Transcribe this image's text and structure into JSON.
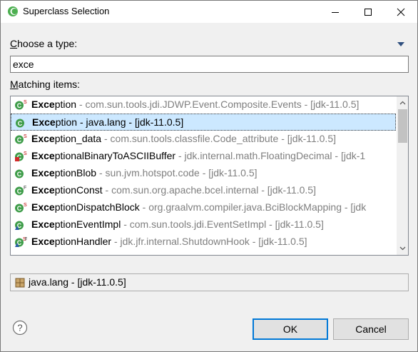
{
  "window": {
    "title": "Superclass Selection",
    "title_icon": "eclipse-icon",
    "controls": [
      "minimize-icon",
      "maximize-icon",
      "close-icon"
    ]
  },
  "form": {
    "type_label_mnemonic": "C",
    "type_label_rest": "hoose a type:",
    "search_value": "exce",
    "matching_label_mnemonic": "M",
    "matching_label_rest": "atching items:"
  },
  "items": [
    {
      "bold": "Exce",
      "rest": "ption",
      "pkg": " - com.sun.tools.jdi.JDWP.Event.Composite.Events - [jdk-11.0.5]",
      "icon": "class-static-icon",
      "selected": false
    },
    {
      "bold": "Exce",
      "rest": "ption - java.lang - [jdk-11.0.5]",
      "pkg": "",
      "icon": "class-icon",
      "selected": true
    },
    {
      "bold": "Exce",
      "rest": "ption_data",
      "pkg": " - com.sun.tools.classfile.Code_attribute - [jdk-11.0.5]",
      "icon": "class-static-icon",
      "selected": false
    },
    {
      "bold": "Exce",
      "rest": "ptionalBinaryToASCIIBuffer",
      "pkg": " - jdk.internal.math.FloatingDecimal - [jdk-1",
      "icon": "class-static-private-icon",
      "selected": false
    },
    {
      "bold": "Exce",
      "rest": "ptionBlob",
      "pkg": " - sun.jvm.hotspot.code - [jdk-11.0.5]",
      "icon": "class-icon",
      "selected": false
    },
    {
      "bold": "Exce",
      "rest": "ptionConst",
      "pkg": " - com.sun.org.apache.bcel.internal - [jdk-11.0.5]",
      "icon": "class-final-icon",
      "selected": false
    },
    {
      "bold": "Exce",
      "rest": "ptionDispatchBlock",
      "pkg": " - org.graalvm.compiler.java.BciBlockMapping - [jdk",
      "icon": "class-static-icon",
      "selected": false
    },
    {
      "bold": "Exce",
      "rest": "ptionEventImpl",
      "pkg": " - com.sun.tools.jdi.EventSetImpl - [jdk-11.0.5]",
      "icon": "class-default-icon",
      "selected": false
    },
    {
      "bold": "Exce",
      "rest": "ptionHandler",
      "pkg": " - jdk.jfr.internal.ShutdownHook - [jdk-11.0.5]",
      "icon": "class-static-final-default-icon",
      "selected": false
    }
  ],
  "status": {
    "icon": "package-icon",
    "text": "java.lang - [jdk-11.0.5]"
  },
  "buttons": {
    "ok_label": "OK",
    "cancel_label": "Cancel",
    "help_icon": "help-icon"
  },
  "colors": {
    "selection": "#cce8ff",
    "class_icon": "#3f9d4a",
    "default_button_border": "#0078d7"
  }
}
